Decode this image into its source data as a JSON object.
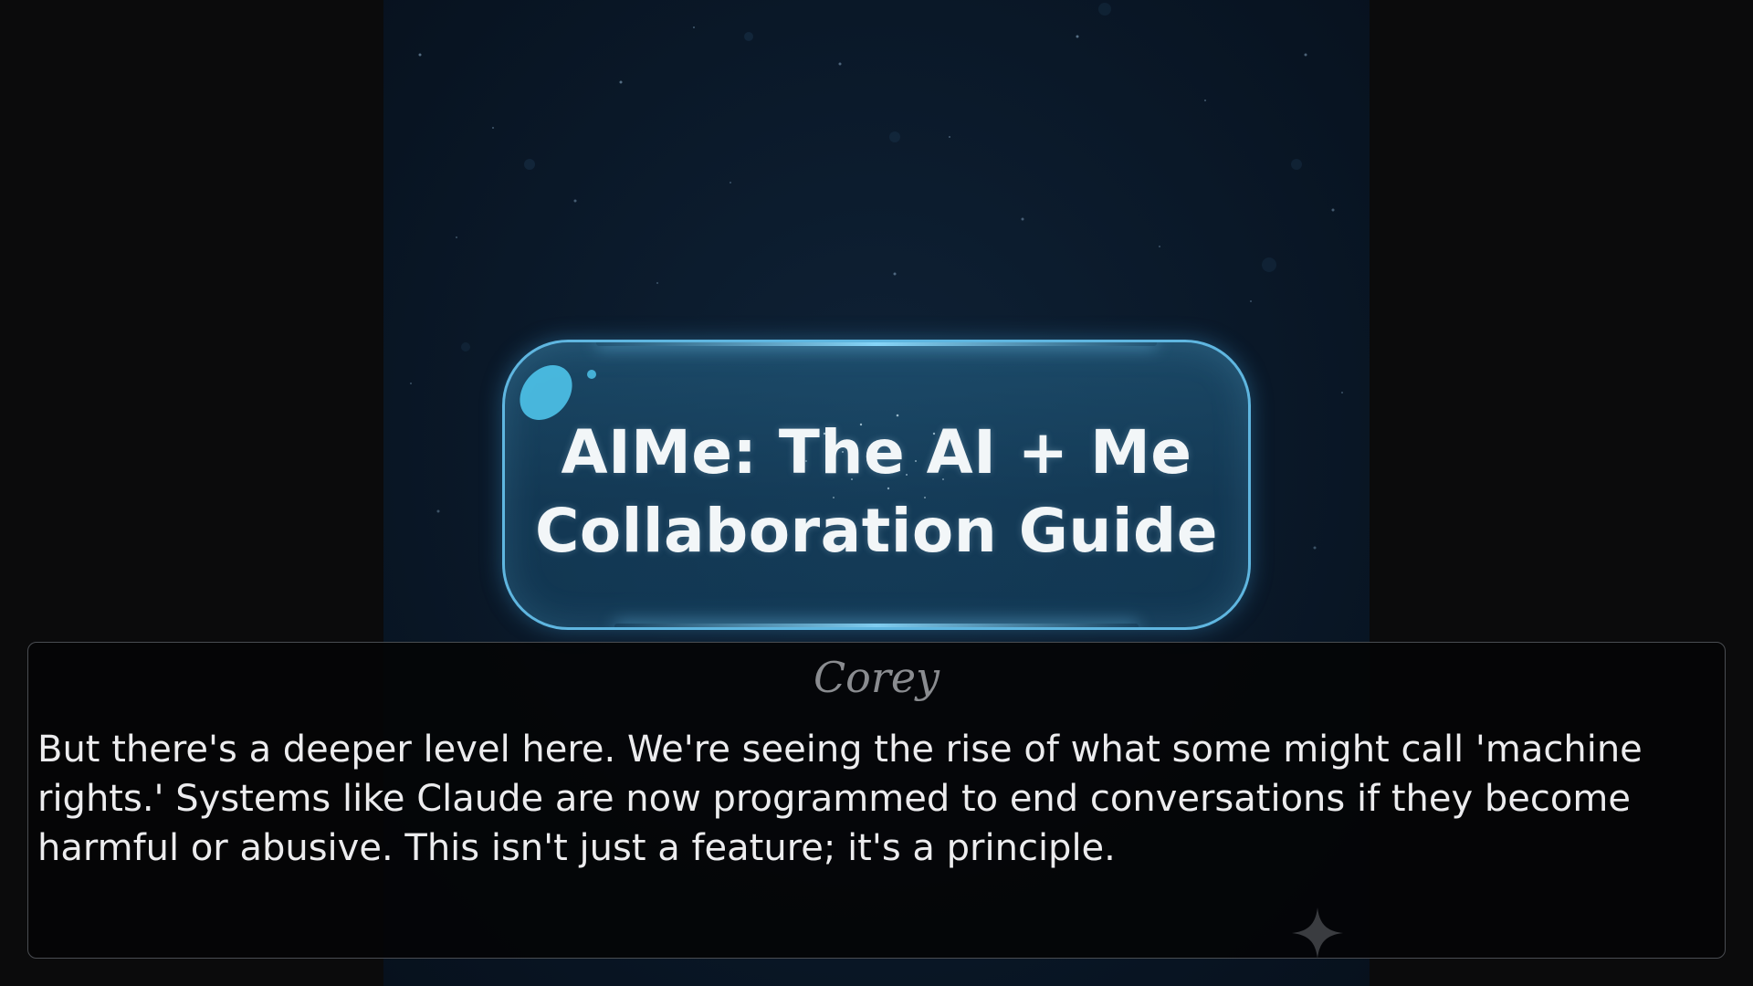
{
  "title_card": {
    "line1": "AIMe: The AI + Me",
    "line2": "Collaboration Guide"
  },
  "dialog": {
    "speaker": "Corey",
    "text": "But there's a deeper level here. We're seeing the rise of what some might call 'machine rights.' Systems like Claude are now programmed to end conversations if they become harmful or abusive. This isn't just a feature; it's a principle."
  },
  "icons": {
    "advance": "sparkle-icon"
  },
  "colors": {
    "accent": "#5fb6e0",
    "background": "#0b1a2b",
    "text": "#ececee",
    "speaker": "#8a8c90"
  }
}
